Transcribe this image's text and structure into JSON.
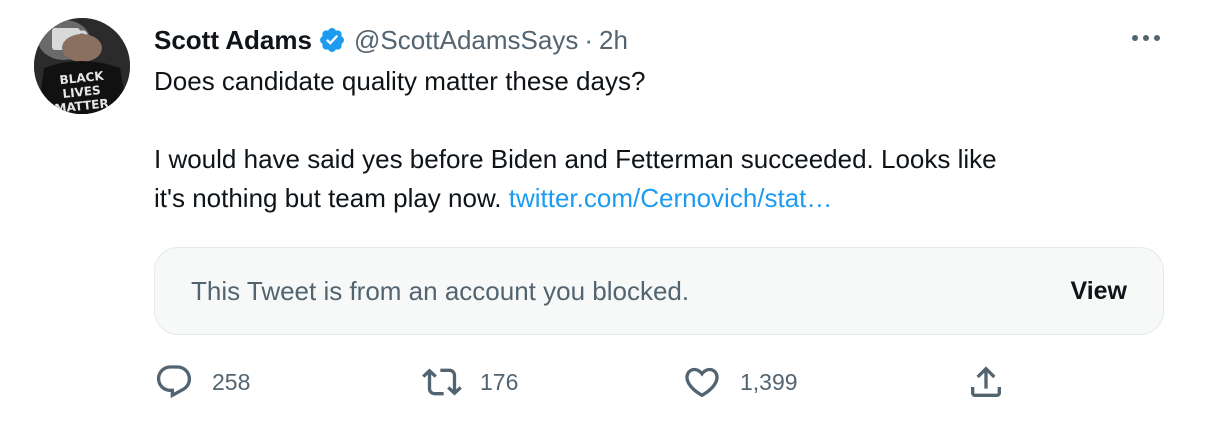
{
  "tweet": {
    "author_name": "Scott Adams",
    "handle": "@ScottAdamsSays",
    "separator": "·",
    "time": "2h",
    "avatar_shirt_text": [
      "BLACK",
      "LIVES",
      "MATTER"
    ],
    "text_line1": "Does candidate quality matter these days?",
    "text_line2": "I would have said yes before Biden and Fetterman succeeded. Looks like",
    "text_line3": "it's nothing but team play now.",
    "link": "twitter.com/Cernovich/stat…"
  },
  "quote": {
    "blocked_message": "This Tweet is from an account you blocked.",
    "view_label": "View"
  },
  "actions": {
    "reply_count": "258",
    "retweet_count": "176",
    "like_count": "1,399"
  },
  "colors": {
    "accent": "#1d9bf0",
    "text_primary": "#0f1419",
    "text_secondary": "#536471",
    "card_background": "#f7f9f9"
  },
  "icons": {
    "verified": "verified-badge-icon",
    "more": "more-horizontal-icon",
    "reply": "reply-icon",
    "retweet": "retweet-icon",
    "like": "heart-icon",
    "share": "share-icon"
  }
}
